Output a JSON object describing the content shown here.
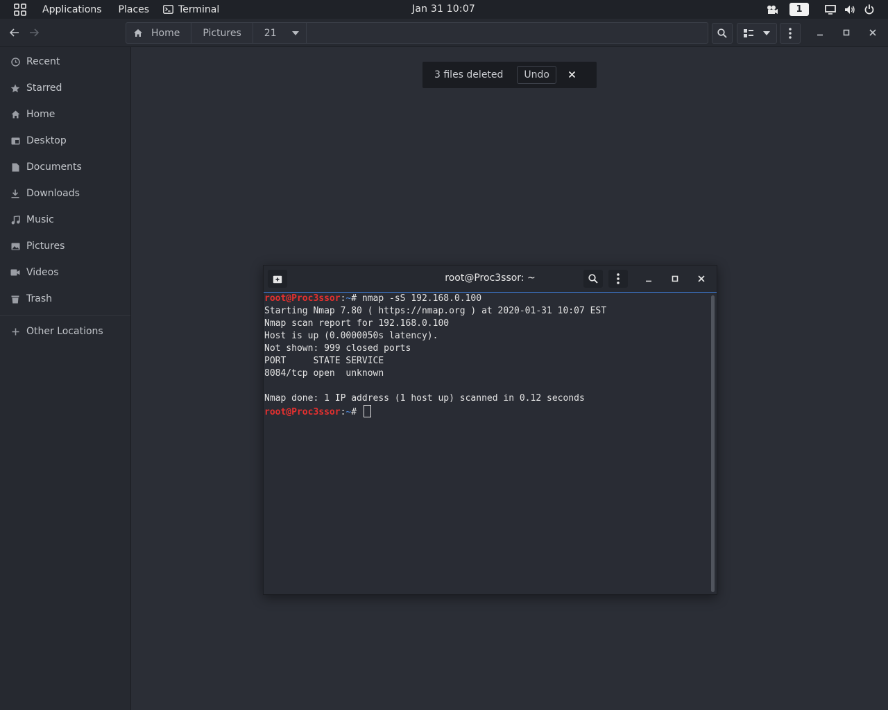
{
  "topbar": {
    "applications": "Applications",
    "places": "Places",
    "terminal": "Terminal",
    "clock": "Jan 31  10:07",
    "workspace": "1",
    "icons": [
      "apps-grid-icon",
      "terminal-icon",
      "camera-icon",
      "display-icon",
      "volume-icon",
      "power-icon"
    ]
  },
  "filemanager": {
    "breadcrumbs": [
      "Home",
      "Pictures",
      "21"
    ],
    "sidebar": {
      "items": [
        {
          "label": "Recent",
          "icon": "clock-icon"
        },
        {
          "label": "Starred",
          "icon": "star-icon"
        },
        {
          "label": "Home",
          "icon": "home-icon"
        },
        {
          "label": "Desktop",
          "icon": "desktop-icon"
        },
        {
          "label": "Documents",
          "icon": "document-icon"
        },
        {
          "label": "Downloads",
          "icon": "download-icon"
        },
        {
          "label": "Music",
          "icon": "music-icon"
        },
        {
          "label": "Pictures",
          "icon": "picture-icon"
        },
        {
          "label": "Videos",
          "icon": "video-icon"
        },
        {
          "label": "Trash",
          "icon": "trash-icon"
        }
      ],
      "other": {
        "label": "Other Locations",
        "icon": "plus-icon"
      }
    },
    "toast": {
      "message": "3 files deleted",
      "undo": "Undo"
    }
  },
  "terminal": {
    "title": "root@Proc3ssor: ~",
    "prompt_user": "root@Proc3ssor",
    "prompt_path": "~",
    "command": "nmap -sS 192.168.0.100",
    "output": [
      "Starting Nmap 7.80 ( https://nmap.org ) at 2020-01-31 10:07 EST",
      "Nmap scan report for 192.168.0.100",
      "Host is up (0.0000050s latency).",
      "Not shown: 999 closed ports",
      "PORT     STATE SERVICE",
      "8084/tcp open  unknown",
      "",
      "Nmap done: 1 IP address (1 host up) scanned in 0.12 seconds"
    ]
  }
}
